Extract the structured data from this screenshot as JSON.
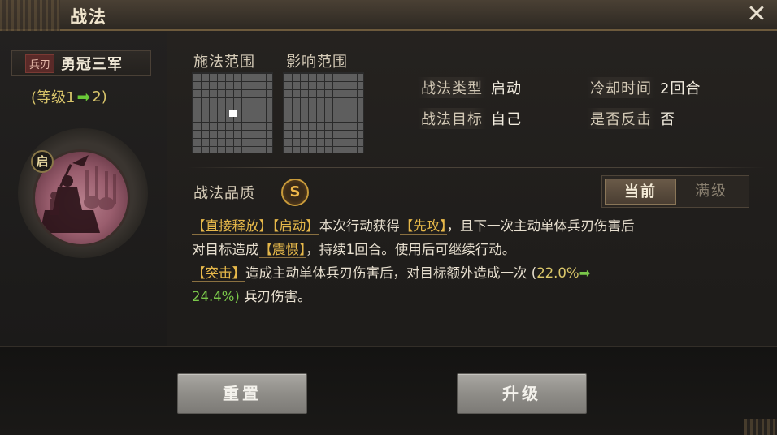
{
  "window": {
    "title": "战法",
    "close_label": "✕"
  },
  "skill": {
    "type_tag": "兵刃",
    "name": "勇冠三军",
    "level_prefix": "(等级1",
    "level_arrow": "➡",
    "level_suffix": "2)",
    "badge": "启"
  },
  "ranges": {
    "cast_label": "施法范围",
    "effect_label": "影响范围"
  },
  "info": {
    "type_key": "战法类型",
    "type_val": "启动",
    "cooldown_key": "冷却时间",
    "cooldown_val": "2回合",
    "target_key": "战法目标",
    "target_val": "自己",
    "counter_key": "是否反击",
    "counter_val": "否"
  },
  "quality": {
    "label": "战法品质",
    "grade": "S"
  },
  "toggle": {
    "current": "当前",
    "max": "满级",
    "selected": "current"
  },
  "description": {
    "line1": {
      "kw1": "【直接释放】",
      "kw2": "【启动】",
      "t1": "本次行动获得",
      "kw3": "【先攻】",
      "t2": "，且下一次主动单体兵刃伤害后"
    },
    "line2": {
      "t1": "对目标造成",
      "kw1": "【震慑】",
      "t2": "，持续1回合。使用后可继续行动。"
    },
    "line3": {
      "kw1": "【突击】",
      "t1": "造成主动单体兵刃伤害后，对目标额外造成一次 (",
      "num1": "22.0%",
      "arrow": "➡"
    },
    "line4": {
      "num2": "24.4%)",
      "t1": " 兵刃伤害。"
    }
  },
  "buttons": {
    "reset": "重置",
    "upgrade": "升级"
  },
  "colors": {
    "accent_gold": "#e6b84a",
    "green": "#7ac84a",
    "level_yellow": "#d8c46a"
  }
}
